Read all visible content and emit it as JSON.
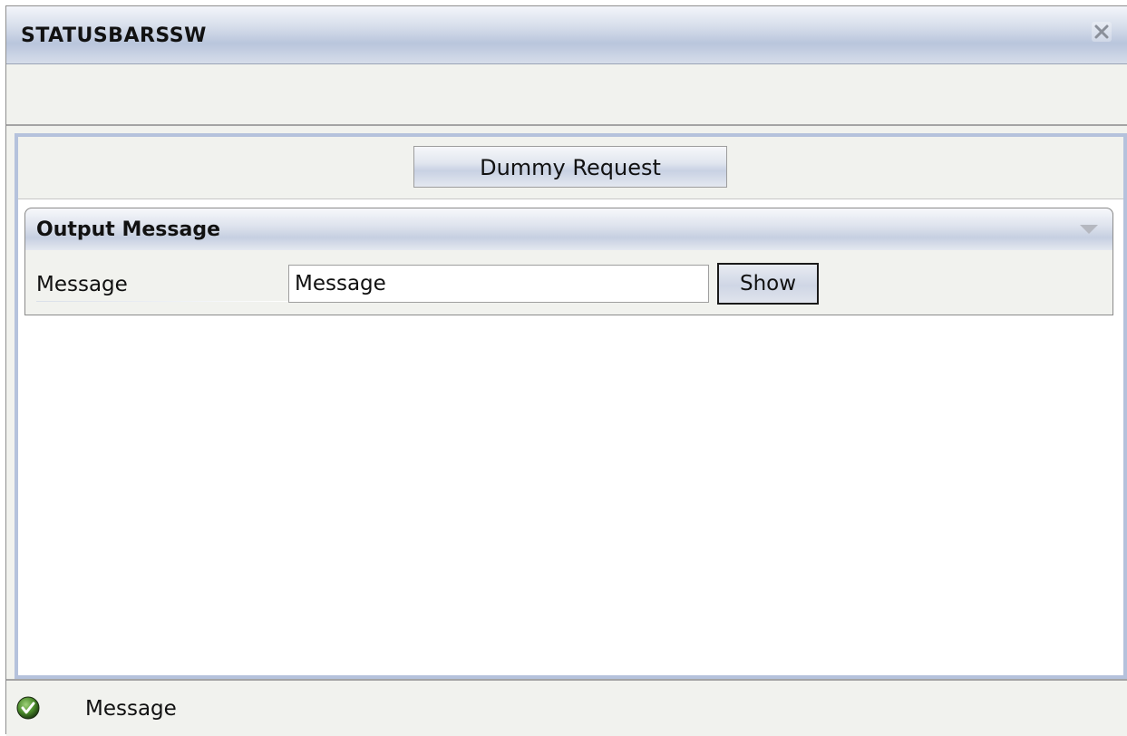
{
  "window": {
    "title": "STATUSBARSSW"
  },
  "toolbar": {
    "dummy_request_label": "Dummy Request"
  },
  "output_group": {
    "title": "Output Message",
    "message_label": "Message",
    "message_value": "Message",
    "show_label": "Show"
  },
  "statusbar": {
    "icon": "check-icon",
    "status_color": "#4a8a2a",
    "text": "Message"
  }
}
